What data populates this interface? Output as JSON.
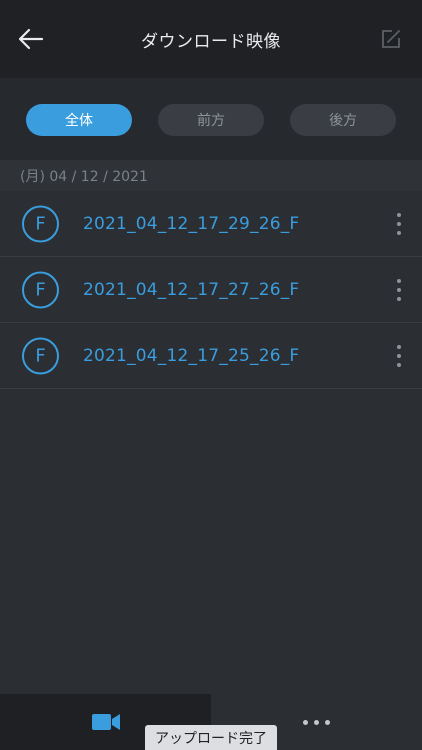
{
  "header": {
    "title": "ダウンロード映像",
    "back_icon": "arrow-left-icon",
    "edit_icon": "edit-icon"
  },
  "filters": {
    "all": "全体",
    "front": "前方",
    "rear": "後方",
    "selected": "全体"
  },
  "date_header": "(月) 04 / 12 / 2021",
  "files": [
    {
      "badge": "F",
      "name": "2021_04_12_17_29_26_F"
    },
    {
      "badge": "F",
      "name": "2021_04_12_17_27_26_F"
    },
    {
      "badge": "F",
      "name": "2021_04_12_17_25_26_F"
    }
  ],
  "tabbar": {
    "video_icon": "video-camera-icon",
    "more_icon": "more-horizontal-icon"
  },
  "toast": "アップロード完了",
  "colors": {
    "accent": "#3a9ddd",
    "header_bg": "#1f2125",
    "background": "#2b2e33"
  }
}
